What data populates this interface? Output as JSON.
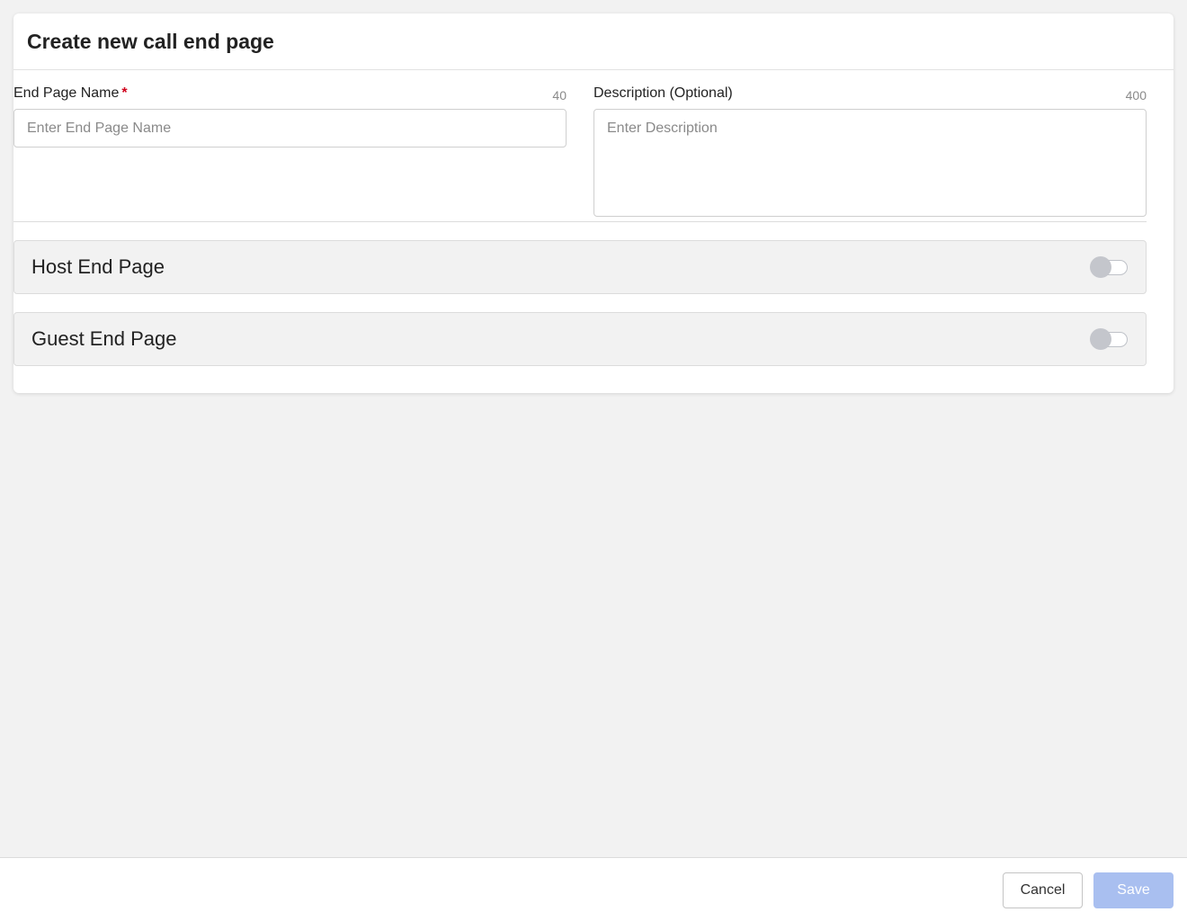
{
  "dialog": {
    "title": "Create new call end page"
  },
  "form": {
    "name_field": {
      "label": "End Page Name",
      "required_marker": "*",
      "counter": "40",
      "placeholder": "Enter End Page Name",
      "value": ""
    },
    "description_field": {
      "label": "Description (Optional)",
      "counter": "400",
      "placeholder": "Enter Description",
      "value": ""
    }
  },
  "sections": {
    "host": {
      "label": "Host End Page",
      "enabled": false
    },
    "guest": {
      "label": "Guest End Page",
      "enabled": false
    }
  },
  "footer": {
    "cancel_label": "Cancel",
    "save_label": "Save"
  },
  "colors": {
    "background": "#f2f2f2",
    "required": "#d0021b",
    "save_disabled": "#a9bff0",
    "toggle_off_knob": "#c4c6cc"
  }
}
